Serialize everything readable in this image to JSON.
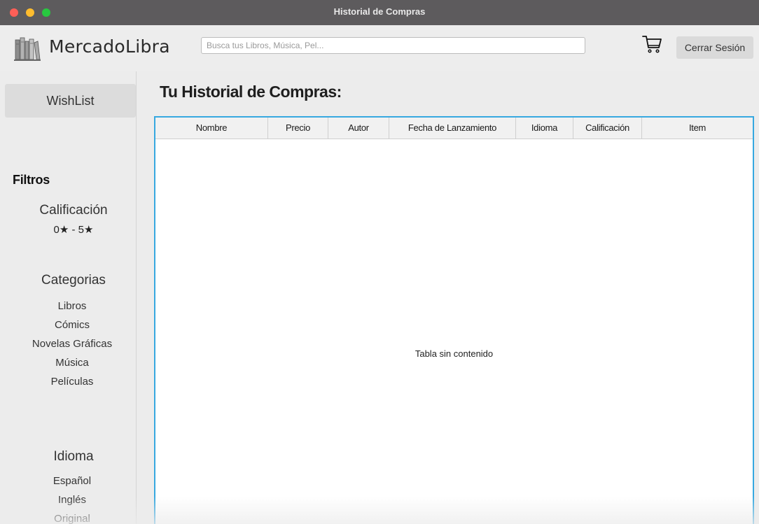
{
  "window": {
    "title": "Historial de Compras"
  },
  "header": {
    "brand": "MercadoLibra",
    "search_placeholder": "Busca tus Libros, Música, Pel...",
    "logout_label": "Cerrar Sesión"
  },
  "sidebar": {
    "wishlist_label": "WishList",
    "filters_title": "Filtros",
    "rating": {
      "title": "Calificación",
      "range": "0★ - 5★"
    },
    "categories": {
      "title": "Categorias",
      "items": [
        "Libros",
        "Cómics",
        "Novelas Gráficas",
        "Música",
        "Películas"
      ]
    },
    "language": {
      "title": "Idioma",
      "items": [
        "Español",
        "Inglés",
        "Original"
      ]
    }
  },
  "main": {
    "title": "Tu Historial de Compras:",
    "table": {
      "columns": [
        "Nombre",
        "Precio",
        "Autor",
        "Fecha de Lanzamiento",
        "Idioma",
        "Calificación",
        "Item"
      ],
      "rows": [],
      "empty_text": "Tabla sin contenido"
    }
  },
  "icons": {
    "window_controls": [
      "close-icon",
      "minimize-icon",
      "zoom-icon"
    ],
    "logo": "books-logo-icon",
    "cart": "cart-icon"
  },
  "colors": {
    "titlebar": "#5d5b5d",
    "close": "#fe5f57",
    "minimize": "#febc2e",
    "zoom": "#28c840",
    "table_focus_border": "#36a8e0"
  }
}
